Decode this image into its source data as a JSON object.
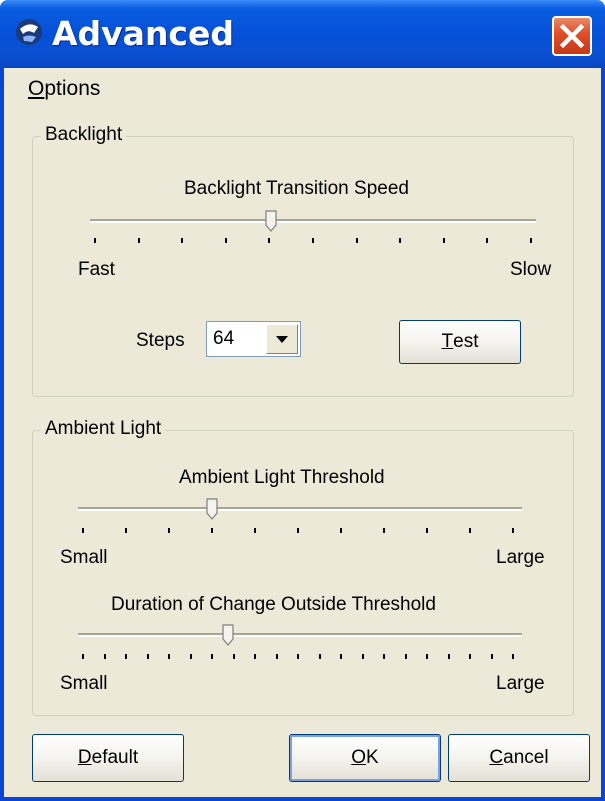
{
  "window": {
    "title": "Advanced",
    "app_icon": "app-icon",
    "close_icon": "close-icon"
  },
  "menu": {
    "options_label_first": "O",
    "options_label_rest": "ptions"
  },
  "backlight": {
    "group_label": "Backlight",
    "slider_label": "Backlight Transition Speed",
    "min_label": "Fast",
    "max_label": "Slow",
    "slider_position_fraction": 0.4,
    "tick_count": 11,
    "steps_label": "Steps",
    "steps_value": "64",
    "test_button_first": "T",
    "test_button_rest": "est"
  },
  "ambient": {
    "group_label": "Ambient Light",
    "threshold_label": "Ambient Light Threshold",
    "threshold_min": "Small",
    "threshold_max": "Large",
    "threshold_position_fraction": 0.31,
    "threshold_tick_count": 11,
    "duration_label": "Duration of Change Outside Threshold",
    "duration_min": "Small",
    "duration_max": "Large",
    "duration_position_fraction": 0.345,
    "duration_tick_count": 21
  },
  "buttons": {
    "default_first": "D",
    "default_rest": "efault",
    "ok_first": "O",
    "ok_rest": "K",
    "cancel_first": "C",
    "cancel_rest": "ancel"
  },
  "colors": {
    "titlebar": "#0551d9",
    "frame": "#ece9d8",
    "close": "#e0502a"
  }
}
